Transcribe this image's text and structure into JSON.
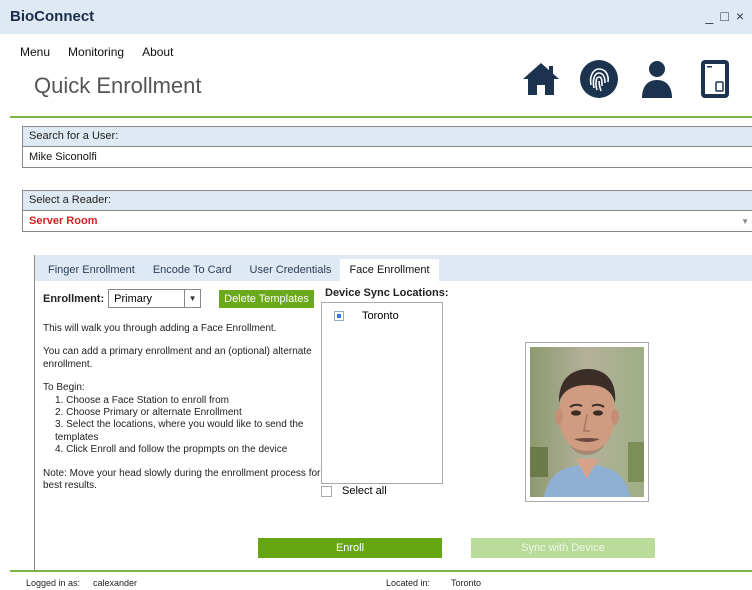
{
  "window": {
    "title": "BioConnect",
    "minimize": "_",
    "maximize": "□",
    "close": "×"
  },
  "menu": {
    "items": [
      "Menu",
      "Monitoring",
      "About"
    ]
  },
  "page": {
    "title": "Quick Enrollment"
  },
  "nav_icons": [
    "home-icon",
    "fingerprint-icon",
    "user-icon",
    "device-icon"
  ],
  "search": {
    "label": "Search for a User:",
    "value": "Mike Siconolfi"
  },
  "reader": {
    "label": "Select a Reader:",
    "value": "Server Room"
  },
  "tabs": [
    {
      "label": "Finger Enrollment"
    },
    {
      "label": "Encode To Card"
    },
    {
      "label": "User Credentials"
    },
    {
      "label": "Face Enrollment"
    }
  ],
  "enrollment": {
    "label": "Enrollment:",
    "selected": "Primary",
    "delete_label": "Delete Templates",
    "intro": "This will walk you through adding a Face Enrollment.",
    "primary_note": "You can add a primary enrollment and an (optional) alternate enrollment.",
    "begin_label": "To Begin:",
    "steps": [
      "1. Choose a Face Station to enroll from",
      "2. Choose Primary or alternate Enrollment",
      "3. Select the locations, where you would like to send the templates",
      "4. Click Enroll and follow the propmpts on the device"
    ],
    "note": "Note: Move your head slowly during the enrollment process for best results."
  },
  "sync": {
    "title": "Device Sync Locations:",
    "locations": [
      "Toronto"
    ],
    "select_all": "Select all"
  },
  "buttons": {
    "enroll": "Enroll",
    "sync_device": "Sync with Device"
  },
  "status": {
    "logged_label": "Logged in as:",
    "logged_value": "calexander",
    "located_label": "Located in:",
    "located_value": "Toronto"
  },
  "colors": {
    "accent_green": "#6aaa1a",
    "header_blue": "#dfe9f3",
    "icon_navy": "#1c3350",
    "reader_red": "#d42020"
  }
}
